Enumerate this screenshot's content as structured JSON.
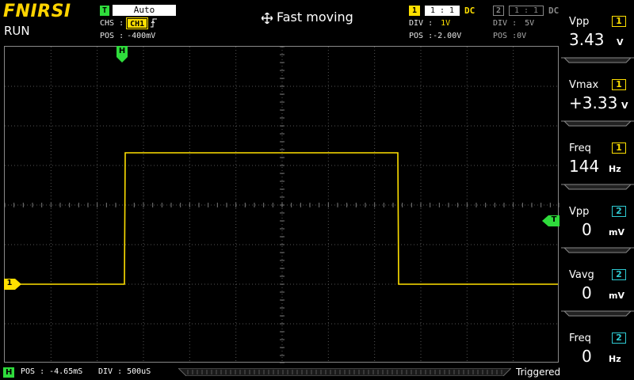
{
  "header": {
    "brand": "FNIRSI",
    "run_state": "RUN",
    "trigger": {
      "badge": "T",
      "mode": "Auto",
      "chs_label": "CHS :",
      "chs_value": "CH1",
      "edge_icon": "rising-edge-icon",
      "pos_label": "POS :",
      "pos_value": "-400mV"
    },
    "mode_label": "Fast moving",
    "ch1": {
      "num": "1",
      "ratio": "1 : 1",
      "coupling": "DC",
      "div_label": "DIV :",
      "div_value": "1V",
      "pos_label": "POS :",
      "pos_value": "-2.00V"
    },
    "ch2": {
      "num": "2",
      "ratio": "1 : 1",
      "coupling": "DC",
      "div_label": "DIV :",
      "div_value": "5V",
      "pos_label": "POS :",
      "pos_value": "0V"
    }
  },
  "markers": {
    "h": "H",
    "t": "T",
    "ch1": "1"
  },
  "measurements": [
    {
      "label": "Vpp",
      "ch": "1",
      "value": "3.43",
      "unit": "V",
      "color": "#ffe000"
    },
    {
      "label": "Vmax",
      "ch": "1",
      "value": "+3.33",
      "unit": "V",
      "color": "#ffe000"
    },
    {
      "label": "Freq",
      "ch": "1",
      "value": "144",
      "unit": "Hz",
      "color": "#ffe000"
    },
    {
      "label": "Vpp",
      "ch": "2",
      "value": "0",
      "unit": "mV",
      "color": "#2ecad2"
    },
    {
      "label": "Vavg",
      "ch": "2",
      "value": "0",
      "unit": "mV",
      "color": "#2ecad2"
    },
    {
      "label": "Freq",
      "ch": "2",
      "value": "0",
      "unit": "Hz",
      "color": "#2ecad2"
    }
  ],
  "footer": {
    "h_badge": "H",
    "pos": "POS : -4.65mS",
    "div": "DIV : 500uS",
    "status": "Triggered"
  },
  "colors": {
    "ch1": "#ffe000",
    "ch2": "#2ecad2",
    "trigger": "#2fdc3c"
  }
}
